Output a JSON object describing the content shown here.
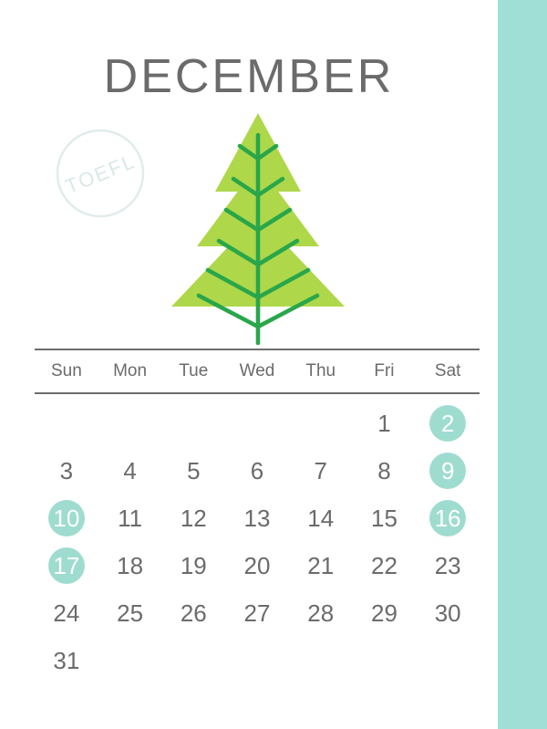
{
  "page": {
    "background_color": "#ffffff",
    "side_band_color": "#9fdfd5"
  },
  "header": {
    "month_title": "DECEMBER"
  },
  "watermark": {
    "text": "TOEFL",
    "color": "#dce9e8"
  },
  "illustration": {
    "name": "christmas-tree",
    "foliage_color": "#aed84a",
    "branch_color": "#2aa64a",
    "trunk_color": "#2aa64a"
  },
  "calendar": {
    "accent_color": "#9fdcd0",
    "text_color": "#6b6b6b",
    "rule_color": "#6d6d6d",
    "weekdays": [
      "Sun",
      "Mon",
      "Tue",
      "Wed",
      "Thu",
      "Fri",
      "Sat"
    ],
    "weeks": [
      [
        {
          "day": "",
          "highlight": false
        },
        {
          "day": "",
          "highlight": false
        },
        {
          "day": "",
          "highlight": false
        },
        {
          "day": "",
          "highlight": false
        },
        {
          "day": "",
          "highlight": false
        },
        {
          "day": "1",
          "highlight": false
        },
        {
          "day": "2",
          "highlight": true
        }
      ],
      [
        {
          "day": "3",
          "highlight": false
        },
        {
          "day": "4",
          "highlight": false
        },
        {
          "day": "5",
          "highlight": false
        },
        {
          "day": "6",
          "highlight": false
        },
        {
          "day": "7",
          "highlight": false
        },
        {
          "day": "8",
          "highlight": false
        },
        {
          "day": "9",
          "highlight": true
        }
      ],
      [
        {
          "day": "10",
          "highlight": true
        },
        {
          "day": "11",
          "highlight": false
        },
        {
          "day": "12",
          "highlight": false
        },
        {
          "day": "13",
          "highlight": false
        },
        {
          "day": "14",
          "highlight": false
        },
        {
          "day": "15",
          "highlight": false
        },
        {
          "day": "16",
          "highlight": true
        }
      ],
      [
        {
          "day": "17",
          "highlight": true
        },
        {
          "day": "18",
          "highlight": false
        },
        {
          "day": "19",
          "highlight": false
        },
        {
          "day": "20",
          "highlight": false
        },
        {
          "day": "21",
          "highlight": false
        },
        {
          "day": "22",
          "highlight": false
        },
        {
          "day": "23",
          "highlight": false
        }
      ],
      [
        {
          "day": "24",
          "highlight": false
        },
        {
          "day": "25",
          "highlight": false
        },
        {
          "day": "26",
          "highlight": false
        },
        {
          "day": "27",
          "highlight": false
        },
        {
          "day": "28",
          "highlight": false
        },
        {
          "day": "29",
          "highlight": false
        },
        {
          "day": "30",
          "highlight": false
        }
      ],
      [
        {
          "day": "31",
          "highlight": false
        },
        {
          "day": "",
          "highlight": false
        },
        {
          "day": "",
          "highlight": false
        },
        {
          "day": "",
          "highlight": false
        },
        {
          "day": "",
          "highlight": false
        },
        {
          "day": "",
          "highlight": false
        },
        {
          "day": "",
          "highlight": false
        }
      ]
    ]
  }
}
